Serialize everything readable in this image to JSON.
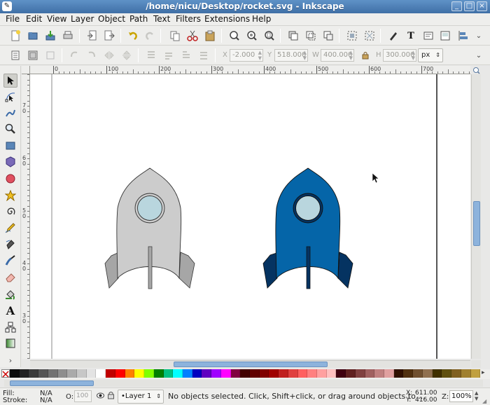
{
  "window": {
    "title": "/home/nicu/Desktop/rocket.svg - Inkscape",
    "controls": [
      "_",
      "□",
      "×"
    ]
  },
  "menu": [
    "File",
    "Edit",
    "View",
    "Layer",
    "Object",
    "Path",
    "Text",
    "Filters",
    "Extensions",
    "Help"
  ],
  "controls_bar": {
    "x_label": "X",
    "x_value": "-2.000",
    "y_label": "Y",
    "y_value": "518.000",
    "w_label": "W",
    "w_value": "400.000",
    "h_label": "H",
    "h_value": "300.000",
    "unit": "px"
  },
  "rulers": {
    "top": [
      "0",
      "100",
      "200",
      "300",
      "400",
      "500",
      "600",
      "700"
    ],
    "left": [
      "7",
      "0",
      "6",
      "0",
      "5",
      "0",
      "4",
      "0",
      "3",
      "0"
    ]
  },
  "palette": [
    "#0c0c0c",
    "#222222",
    "#3a3a3a",
    "#555555",
    "#727272",
    "#8e8e8e",
    "#aaaaaa",
    "#c7c7c7",
    "#e3e3e3",
    "#ffffff",
    "#c00000",
    "#ff0000",
    "#ff8000",
    "#ffff00",
    "#80ff00",
    "#008000",
    "#00c080",
    "#00ffff",
    "#0080ff",
    "#0000c0",
    "#6000c0",
    "#a000ff",
    "#ff00ff",
    "#800040",
    "#400000",
    "#600000",
    "#800000",
    "#a00000",
    "#c02020",
    "#e04040",
    "#ff6060",
    "#ff8080",
    "#ffa0a0",
    "#ffc0c0",
    "#400010",
    "#602020",
    "#804040",
    "#a06060",
    "#c08080",
    "#e0a0a0",
    "#301000",
    "#503010",
    "#705030",
    "#907050",
    "#403000",
    "#605010",
    "#806020",
    "#a08030",
    "#c0a040"
  ],
  "status": {
    "fill_label": "Fill:",
    "fill_value": "N/A",
    "stroke_label": "Stroke:",
    "stroke_value": "N/A",
    "opacity_label": "O:",
    "opacity_value": "100",
    "layer": "•Layer 1",
    "message": "No objects selected. Click, Shift+click, or drag around objects to ...",
    "x_label": "X:",
    "x_value": "611.00",
    "y_label": "Y:",
    "y_value": "416.00",
    "zoom_label": "Z:",
    "zoom_value": "100%"
  },
  "colors": {
    "rocket_gray_body": "#cccccc",
    "rocket_gray_fin": "#a6a6a6",
    "rocket_blue_body": "#0565a8",
    "rocket_blue_fin": "#053361",
    "window_glass": "#b9d6de"
  }
}
